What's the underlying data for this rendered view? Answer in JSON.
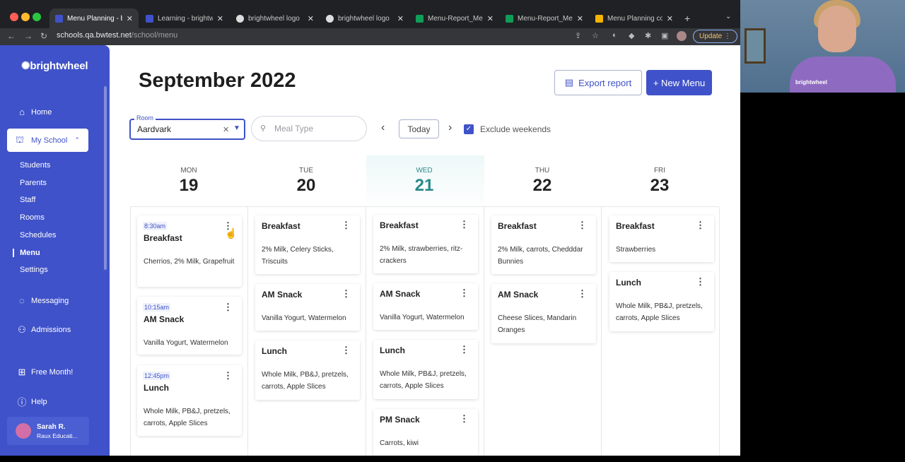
{
  "browser": {
    "tabs": [
      {
        "label": "Menu Planning - br",
        "active": true,
        "icon": "bw-favicon"
      },
      {
        "label": "Learning - brightwh",
        "active": false,
        "icon": "bw-favicon"
      },
      {
        "label": "brightwheel logo",
        "active": false,
        "icon": "globe-icon"
      },
      {
        "label": "brightwheel logo",
        "active": false,
        "icon": "globe-icon"
      },
      {
        "label": "Menu-Report_Menu",
        "active": false,
        "icon": "sheets-icon"
      },
      {
        "label": "Menu-Report_Menu",
        "active": false,
        "icon": "sheets-icon"
      },
      {
        "label": "Menu Planning con",
        "active": false,
        "icon": "slides-icon"
      }
    ],
    "url_host": "schools.qa.bwtest.net",
    "url_path": "/school/menu",
    "update_label": "Update"
  },
  "sidebar": {
    "logo": "brightwheel",
    "home": "Home",
    "my_school": "My School",
    "sub_items": [
      "Students",
      "Parents",
      "Staff",
      "Rooms",
      "Schedules",
      "Menu",
      "Settings"
    ],
    "active_sub": "Menu",
    "messaging": "Messaging",
    "admissions": "Admissions",
    "free_month": "Free Month!",
    "help": "Help",
    "user_name": "Sarah R.",
    "user_org": "Raux Educati..."
  },
  "page": {
    "title": "September 2022",
    "export_label": "Export report",
    "new_menu_label": "+ New Menu",
    "room_label": "Room",
    "room_value": "Aardvark",
    "meal_type_placeholder": "Meal Type",
    "today_label": "Today",
    "exclude_weekends_label": "Exclude weekends",
    "exclude_weekends_checked": true
  },
  "days": [
    {
      "dow": "MON",
      "date": "19",
      "today": false,
      "cards": [
        {
          "time": "8:30am",
          "meal": "Breakfast",
          "items": "Cherrios, 2% Milk, Grapefruit"
        },
        {
          "time": "10:15am",
          "meal": "AM Snack",
          "items": "Vanilla Yogurt, Watermelon"
        },
        {
          "time": "12:45pm",
          "meal": "Lunch",
          "items": "Whole Milk, PB&J, pretzels, carrots, Apple Slices"
        }
      ]
    },
    {
      "dow": "TUE",
      "date": "20",
      "today": false,
      "cards": [
        {
          "meal": "Breakfast",
          "items": "2% Milk, Celery Sticks, Triscuits"
        },
        {
          "meal": "AM Snack",
          "items": "Vanilla Yogurt, Watermelon"
        },
        {
          "meal": "Lunch",
          "items": "Whole Milk, PB&J, pretzels, carrots, Apple Slices"
        }
      ]
    },
    {
      "dow": "WED",
      "date": "21",
      "today": true,
      "cards": [
        {
          "meal": "Breakfast",
          "items": "2% Milk, strawberries, ritz-crackers"
        },
        {
          "meal": "AM Snack",
          "items": "Vanilla Yogurt, Watermelon"
        },
        {
          "meal": "Lunch",
          "items": "Whole Milk, PB&J, pretzels, carrots, Apple Slices"
        },
        {
          "meal": "PM Snack",
          "items": "Carrots, kiwi"
        }
      ]
    },
    {
      "dow": "THU",
      "date": "22",
      "today": false,
      "cards": [
        {
          "meal": "Breakfast",
          "items": "2% Milk, carrots, Chedddar Bunnies"
        },
        {
          "meal": "AM Snack",
          "items": "Cheese Slices, Mandarin Oranges"
        }
      ]
    },
    {
      "dow": "FRI",
      "date": "23",
      "today": false,
      "cards": [
        {
          "meal": "Breakfast",
          "items": "Strawberries"
        },
        {
          "meal": "Lunch",
          "items": "Whole Milk, PB&J, pretzels, carrots, Apple Slices"
        }
      ]
    }
  ],
  "webcam": {
    "shirt_text": "brightwheel"
  },
  "colors": {
    "brand": "#3f52c9",
    "today_accent": "#2a8a8a"
  }
}
